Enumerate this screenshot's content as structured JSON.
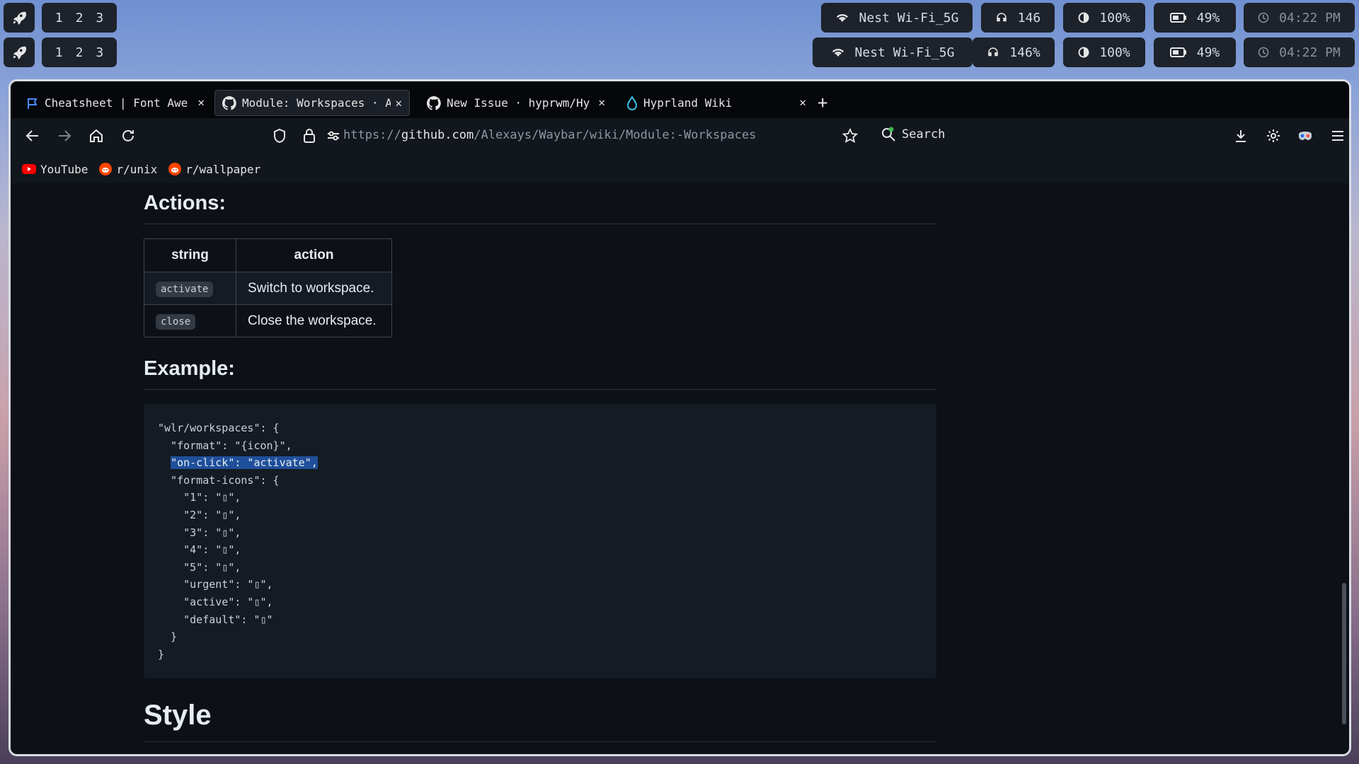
{
  "waybar": {
    "top": {
      "workspaces": [
        "1",
        "2",
        "3"
      ],
      "wifi": "Nest Wi-Fi_5G",
      "volume": "146",
      "brightness": "100%",
      "battery": "49%",
      "clock": "04:22 PM"
    },
    "bottom": {
      "workspaces": [
        "1",
        "2",
        "3"
      ],
      "wifi": "Nest Wi-Fi_5G",
      "volume": "146%",
      "brightness": "100%",
      "battery": "49%",
      "clock": "04:22 PM"
    }
  },
  "tabs": [
    {
      "title": "Cheatsheet | Font Awe"
    },
    {
      "title": "Module: Workspaces · A"
    },
    {
      "title": "New Issue · hyprwm/Hy"
    },
    {
      "title": "Hyprland Wiki"
    }
  ],
  "toolbar": {
    "url_scheme": "https://",
    "url_host": "github.com",
    "url_path": "/Alexays/Waybar/wiki/Module:-Workspaces",
    "search_label": "Search"
  },
  "bookmarks": [
    {
      "label": "YouTube"
    },
    {
      "label": "r/unix"
    },
    {
      "label": "r/wallpaper"
    }
  ],
  "article": {
    "actions_heading": "Actions:",
    "table": {
      "headers": [
        "string",
        "action"
      ],
      "rows": [
        {
          "string": "activate",
          "action": "Switch to workspace."
        },
        {
          "string": "close",
          "action": "Close the workspace."
        }
      ]
    },
    "example_heading": "Example:",
    "code_lines": [
      "\"wlr/workspaces\": {",
      "  \"format\": \"{icon}\",",
      "  \"on-click\": \"activate\",",
      "  \"format-icons\": {",
      "    \"1\": \"▯\",",
      "    \"2\": \"▯\",",
      "    \"3\": \"▯\",",
      "    \"4\": \"▯\",",
      "    \"5\": \"▯\",",
      "    \"urgent\": \"▯\",",
      "    \"active\": \"▯\",",
      "    \"default\": \"▯\"",
      "  }",
      "}"
    ],
    "style_heading": "Style"
  },
  "colors": {
    "selection": "#1f4f9a",
    "page_bg": "#0d1117",
    "code_bg": "#151b23"
  }
}
